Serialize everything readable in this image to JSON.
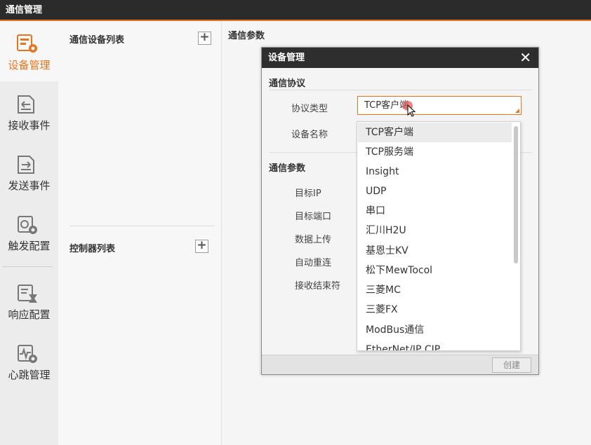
{
  "window": {
    "title": "通信管理"
  },
  "sidebar": {
    "items": [
      {
        "label": "设备管理",
        "icon": "device-manage-icon",
        "active": true
      },
      {
        "label": "接收事件",
        "icon": "receive-event-icon",
        "active": false
      },
      {
        "label": "发送事件",
        "icon": "send-event-icon",
        "active": false
      },
      {
        "label": "触发配置",
        "icon": "trigger-config-icon",
        "active": false
      },
      {
        "label": "响应配置",
        "icon": "response-config-icon",
        "active": false
      },
      {
        "label": "心跳管理",
        "icon": "heartbeat-manage-icon",
        "active": false
      }
    ]
  },
  "list_panel": {
    "device_list_title": "通信设备列表",
    "controller_list_title": "控制器列表",
    "add_symbol": "+"
  },
  "main": {
    "title": "通信参数"
  },
  "dialog": {
    "title": "设备管理",
    "close_symbol": "✕",
    "protocol_section": "通信协议",
    "protocol_type_label": "协议类型",
    "protocol_type_value": "TCP客户端",
    "device_name_label": "设备名称",
    "params_section": "通信参数",
    "param_labels": [
      "目标IP",
      "目标端口",
      "数据上传",
      "自动重连",
      "接收结束符"
    ],
    "create_button": "创建"
  },
  "dropdown": {
    "selected_index": 0,
    "options": [
      "TCP客户端",
      "TCP服务端",
      "Insight",
      "UDP",
      "串口",
      "汇川H2U",
      "基恩士KV",
      "松下MewTocol",
      "三菱MC",
      "三菱FX",
      "ModBus通信",
      "EtherNet/IP CIP"
    ]
  },
  "colors": {
    "accent": "#e8741e",
    "titlebar": "#2b2b2b",
    "dialog_header": "#2e2e2e"
  }
}
